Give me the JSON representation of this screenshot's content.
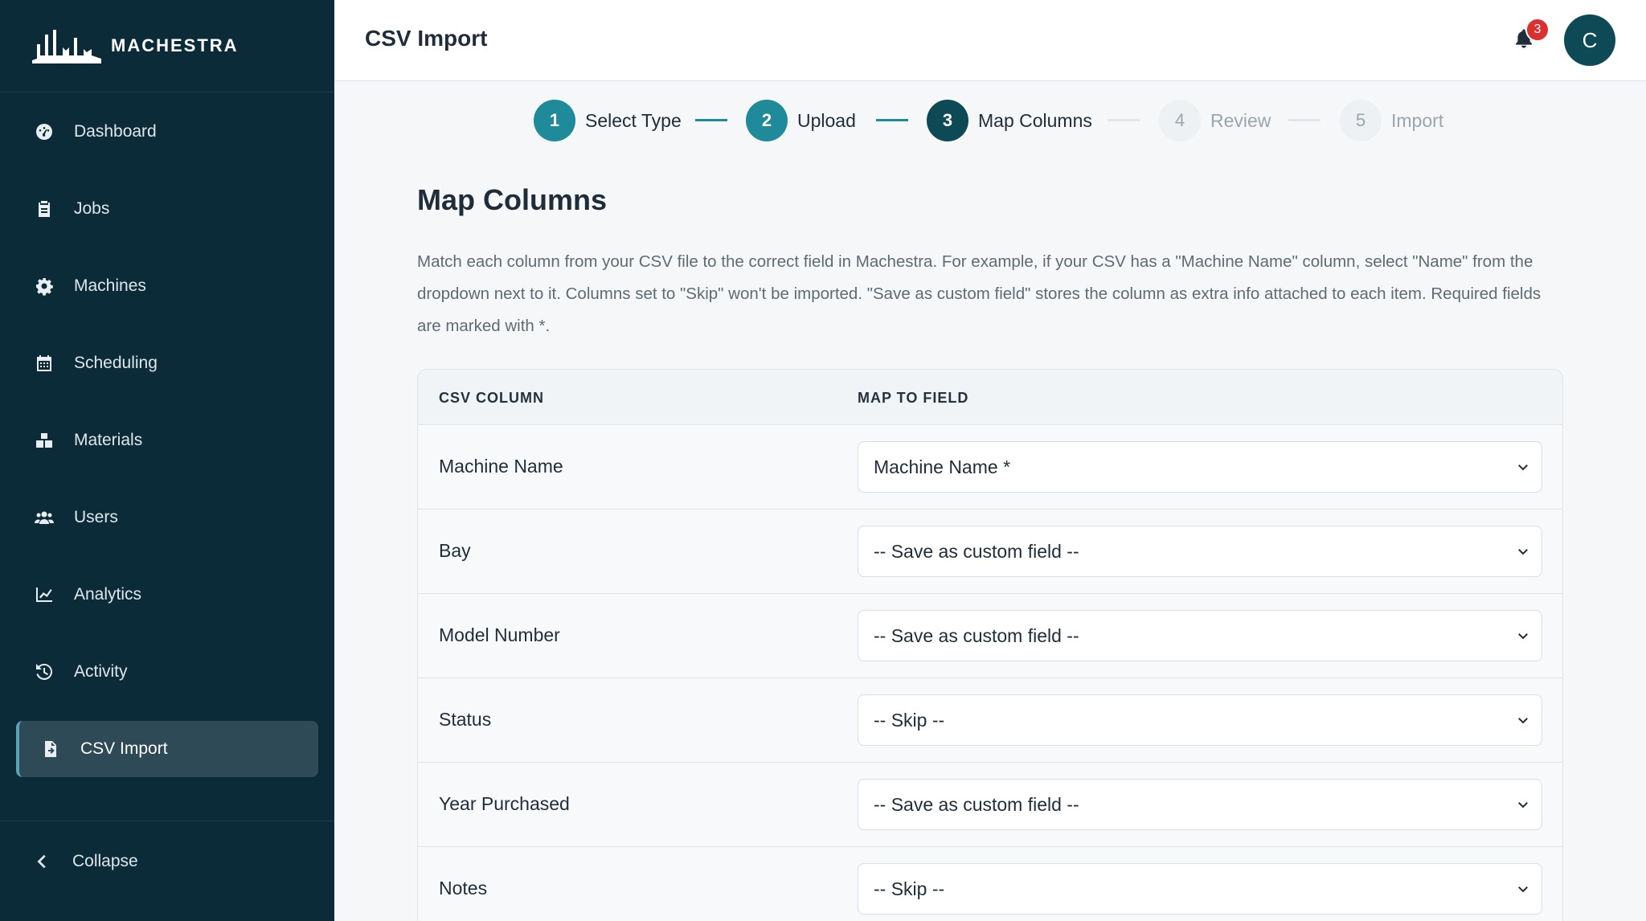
{
  "brand": {
    "name": "MACHESTRA"
  },
  "sidebar": {
    "items": [
      {
        "label": "Dashboard",
        "icon": "dashboard-icon"
      },
      {
        "label": "Jobs",
        "icon": "clipboard-icon"
      },
      {
        "label": "Machines",
        "icon": "gear-icon"
      },
      {
        "label": "Scheduling",
        "icon": "calendar-icon"
      },
      {
        "label": "Materials",
        "icon": "boxes-icon"
      },
      {
        "label": "Users",
        "icon": "users-icon"
      },
      {
        "label": "Analytics",
        "icon": "chart-line-icon"
      },
      {
        "label": "Activity",
        "icon": "history-icon"
      },
      {
        "label": "CSV Import",
        "icon": "file-import-icon",
        "active": true
      }
    ],
    "collapse_label": "Collapse"
  },
  "header": {
    "title": "CSV Import",
    "notification_count": "3",
    "avatar_initial": "C"
  },
  "stepper": {
    "steps": [
      {
        "num": "1",
        "label": "Select Type",
        "state": "done"
      },
      {
        "num": "2",
        "label": "Upload",
        "state": "done"
      },
      {
        "num": "3",
        "label": "Map Columns",
        "state": "current"
      },
      {
        "num": "4",
        "label": "Review",
        "state": "todo"
      },
      {
        "num": "5",
        "label": "Import",
        "state": "todo"
      }
    ]
  },
  "main": {
    "title": "Map Columns",
    "description": "Match each column from your CSV file to the correct field in Machestra. For example, if your CSV has a \"Machine Name\" column, select \"Name\" from the dropdown next to it. Columns set to \"Skip\" won't be imported. \"Save as custom field\" stores the column as extra info attached to each item. Required fields are marked with *.",
    "table": {
      "headers": [
        "CSV COLUMN",
        "MAP TO FIELD"
      ],
      "rows": [
        {
          "column": "Machine Name",
          "mapping": "Machine Name *"
        },
        {
          "column": "Bay",
          "mapping": "-- Save as custom field --"
        },
        {
          "column": "Model Number",
          "mapping": "-- Save as custom field --"
        },
        {
          "column": "Status",
          "mapping": "-- Skip --"
        },
        {
          "column": "Year Purchased",
          "mapping": "-- Save as custom field --"
        },
        {
          "column": "Notes",
          "mapping": "-- Skip --"
        }
      ]
    }
  },
  "colors": {
    "sidebar_bg": "#0b2b39",
    "step_done": "#1f8a99",
    "step_current": "#0e4a55",
    "badge": "#d93030"
  }
}
